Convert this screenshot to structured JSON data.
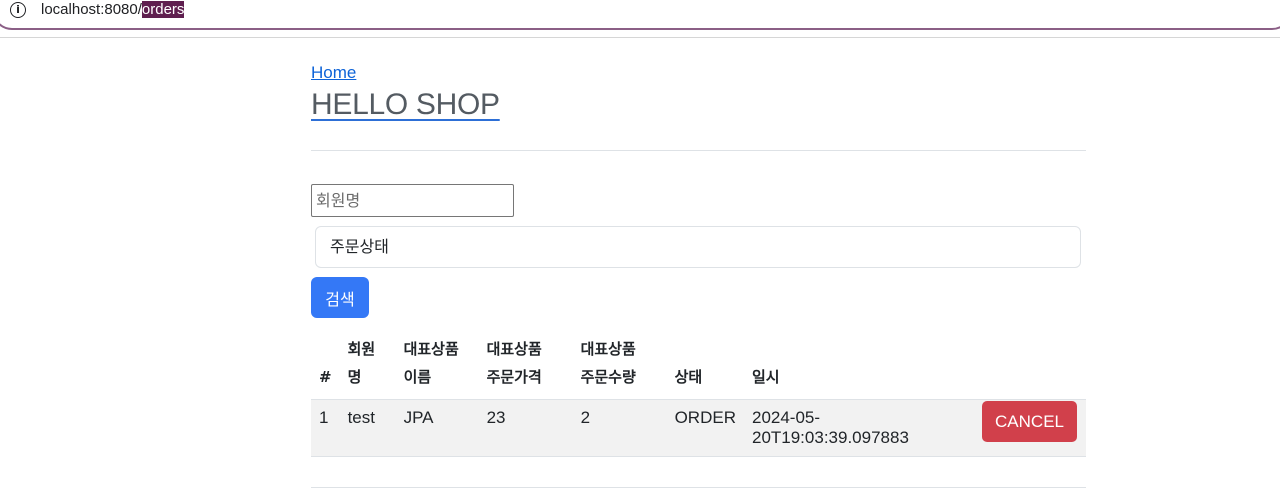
{
  "browser": {
    "url_prefix": "localhost:8080/",
    "url_selected": "orders"
  },
  "header": {
    "home_link": "Home",
    "brand": "HELLO SHOP"
  },
  "search": {
    "member_name_placeholder": "회원명",
    "order_status_value": "주문상태",
    "search_button": "검색"
  },
  "table": {
    "headers": [
      "#",
      "회원\n명",
      "대표상품\n이름",
      "대표상품\n주문가격",
      "대표상품\n주문수량",
      "상태",
      "일시"
    ],
    "rows": [
      {
        "id": "1",
        "member": "test",
        "item_name": "JPA",
        "order_price": "23",
        "order_count": "2",
        "status": "ORDER",
        "order_date": "2024-05-\n20T19:03:39.097883",
        "action": "CANCEL"
      }
    ]
  },
  "colors": {
    "primary": "#3478f6",
    "danger": "#d1404b",
    "link": "#0d63d8"
  }
}
